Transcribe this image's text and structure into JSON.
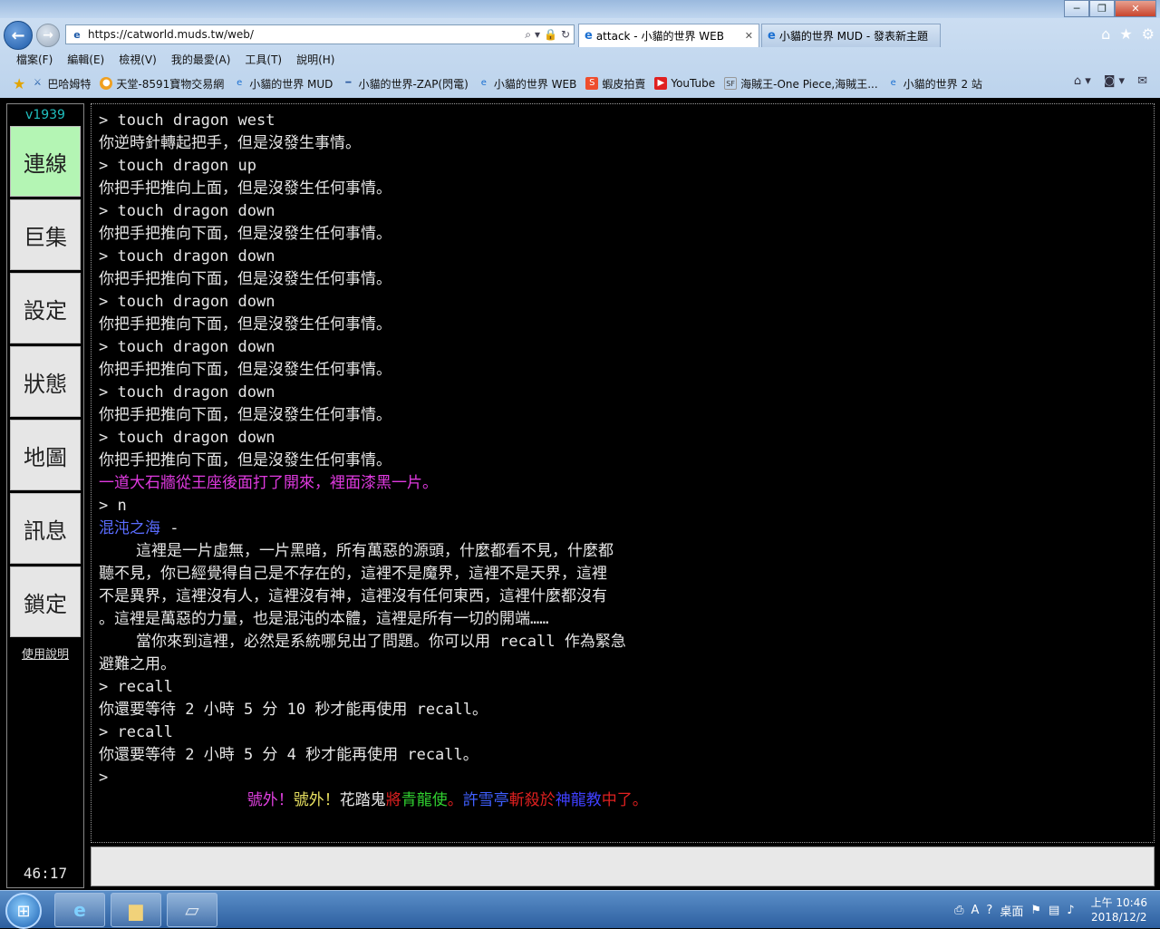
{
  "window": {
    "controls": [
      "─",
      "❐",
      "✕"
    ]
  },
  "address": {
    "url": "https://catworld.muds.tw/web/"
  },
  "tabs": [
    {
      "label": "attack - 小貓的世界 WEB",
      "active": true
    },
    {
      "label": "小貓的世界 MUD - 發表新主題",
      "active": false
    }
  ],
  "menu": [
    "檔案(F)",
    "編輯(E)",
    "檢視(V)",
    "我的最愛(A)",
    "工具(T)",
    "說明(H)"
  ],
  "favorites": [
    "巴哈姆特",
    "天堂-8591寶物交易網",
    "小貓的世界 MUD",
    "小貓的世界-ZAP(閃電)",
    "小貓的世界 WEB",
    "蝦皮拍賣",
    "YouTube",
    "海賊王-One Piece,海賊王...",
    "小貓的世界 2 站"
  ],
  "sidebar": {
    "version": "v1939",
    "buttons": [
      "連線",
      "巨集",
      "設定",
      "狀態",
      "地圖",
      "訊息",
      "鎖定"
    ],
    "help": "使用說明",
    "clock": "46:17"
  },
  "terminal": {
    "lines": [
      "> touch dragon west",
      "你逆時針轉起把手，但是沒發生事情。",
      "> touch dragon up",
      "你把手把推向上面，但是沒發生任何事情。",
      "> touch dragon down",
      "你把手把推向下面，但是沒發生任何事情。",
      "> touch dragon down",
      "你把手把推向下面，但是沒發生任何事情。",
      "> touch dragon down",
      "你把手把推向下面，但是沒發生任何事情。",
      "> touch dragon down",
      "你把手把推向下面，但是沒發生任何事情。",
      "> touch dragon down",
      "你把手把推向下面，但是沒發生任何事情。",
      "> touch dragon down",
      "你把手把推向下面，但是沒發生任何事情。"
    ],
    "magenta_line": "一道大石牆從王座後面打了開來，裡面漆黑一片。",
    "cmd_n": "> n",
    "room_name": "混沌之海",
    "room_suffix": " -",
    "room_desc": [
      "    這裡是一片虛無，一片黑暗，所有萬惡的源頭，什麼都看不見，什麼都",
      "聽不見，你已經覺得自己是不存在的，這裡不是魔界，這裡不是天界，這裡",
      "不是異界，這裡沒有人，這裡沒有神，這裡沒有任何東西，這裡什麼都沒有",
      "。這裡是萬惡的力量，也是混沌的本體，這裡是所有一切的開端……",
      "    當你來到這裡，必然是系統哪兒出了問題。你可以用 recall 作為緊急",
      "避難之用。"
    ],
    "tail_lines": [
      "> recall",
      "你還要等待 2 小時 5 分 10 秒才能再使用 recall。",
      "> recall",
      "你還要等待 2 小時 5 分 4 秒才能再使用 recall。",
      ">"
    ],
    "announcement": [
      {
        "text": "號外！",
        "color": "#e040e0"
      },
      {
        "text": "號外！",
        "color": "#e8e060"
      },
      {
        "text": "花踏鬼",
        "color": "#e6e6e6"
      },
      {
        "text": "將",
        "color": "#e02020"
      },
      {
        "text": "青龍使",
        "color": "#30d030"
      },
      {
        "text": "。",
        "color": "#e02020"
      },
      {
        "text": "許雪亭",
        "color": "#4060ff"
      },
      {
        "text": "斬殺於",
        "color": "#e02020"
      },
      {
        "text": "神龍教",
        "color": "#4040ff"
      },
      {
        "text": "中了。",
        "color": "#e02020"
      }
    ]
  },
  "taskbar": {
    "tray_label": "桌面",
    "time": "上午 10:46",
    "date": "2018/12/2"
  }
}
